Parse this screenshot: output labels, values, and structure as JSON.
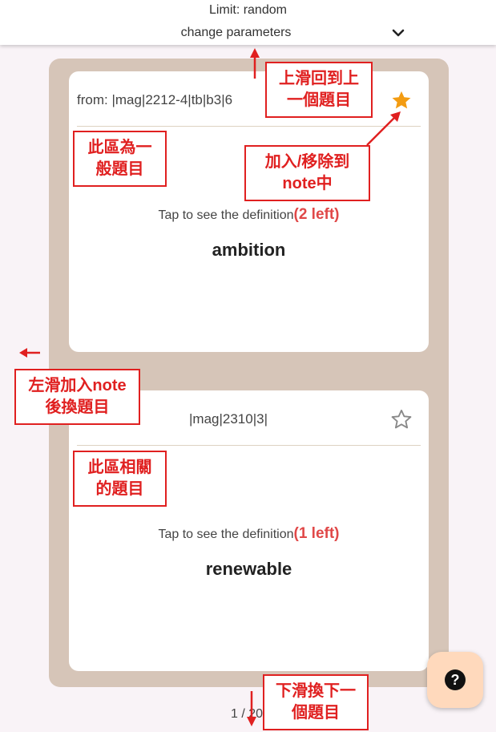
{
  "header": {
    "limit_text": "Limit: random",
    "change_parameters": "change parameters",
    "chevron_icon": "chevron-down-icon"
  },
  "cards": [
    {
      "from": "from: |mag|2212-4|tb|b3|6",
      "starred": true,
      "tap_text": "Tap to see the definition",
      "left_text": "(2 left)",
      "word": "ambition"
    },
    {
      "from": "|mag|2310|3|",
      "starred": false,
      "tap_text": "Tap to see the definition",
      "left_text": "(1 left)",
      "word": "renewable"
    }
  ],
  "pager": {
    "text": "1 / 20"
  },
  "annotations": {
    "swipe_up": "上滑回到上\n一個題目",
    "general_area": "此區為一\n般題目",
    "note_toggle": "加入/移除到\nnote中",
    "swipe_left": "左滑加入note\n後換題目",
    "related_area": "此區相關\n的題目",
    "swipe_down": "下滑換下一\n個題目"
  },
  "colors": {
    "accent_star": "#f39c12",
    "annotation_red": "#e02020",
    "panel": "#d6c5b8",
    "help_bg": "#ffd9bc"
  }
}
